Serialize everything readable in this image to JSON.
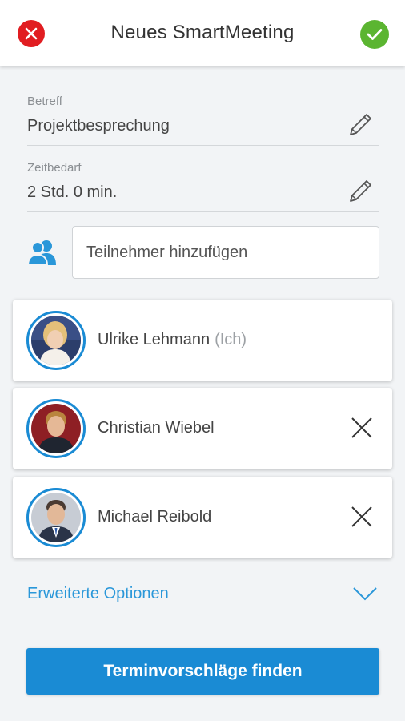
{
  "header": {
    "title": "Neues SmartMeeting",
    "cancel_icon": "close-icon",
    "confirm_icon": "check-icon",
    "colors": {
      "cancel": "#e11d21",
      "confirm": "#5bb531"
    }
  },
  "fields": {
    "subject": {
      "label": "Betreff",
      "value": "Projektbesprechung",
      "icon": "pencil-icon"
    },
    "duration": {
      "label": "Zeitbedarf",
      "value": "2 Std. 0 min.",
      "icon": "pencil-icon"
    }
  },
  "participants": {
    "icon": "people-icon",
    "add_placeholder": "Teilnehmer hinzufügen",
    "items": [
      {
        "name": "Ulrike Lehmann",
        "suffix": "(Ich)",
        "removable": false
      },
      {
        "name": "Christian Wiebel",
        "suffix": "",
        "removable": true
      },
      {
        "name": "Michael Reibold",
        "suffix": "",
        "removable": true
      }
    ]
  },
  "advanced": {
    "label": "Erweiterte Optionen",
    "icon": "chevron-down-icon"
  },
  "primary_button": {
    "label": "Terminvorschläge finden"
  },
  "accent_color": "#1a8bd4"
}
